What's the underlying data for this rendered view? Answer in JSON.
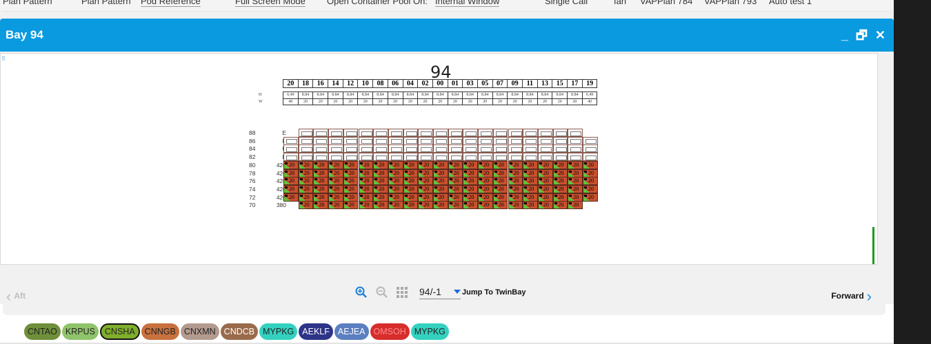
{
  "topbar": {
    "items": [
      "Plan Pattern",
      "Plan Pattern",
      "Pod Reference",
      "Full Screen Mode",
      "Open Container Pool On:",
      "Internal Window",
      "Single Call",
      "Ian",
      "VAPPlan 784",
      "VAPPlan 793",
      "Auto test 1"
    ]
  },
  "dialog": {
    "title": "Bay 94",
    "minimize_label": "_",
    "restore_label": "🗗",
    "close_label": "✕"
  },
  "bay": {
    "number": "94",
    "rows": [
      "20",
      "18",
      "16",
      "14",
      "12",
      "10",
      "08",
      "06",
      "04",
      "02",
      "00",
      "01",
      "03",
      "05",
      "07",
      "09",
      "11",
      "13",
      "15",
      "17",
      "19"
    ],
    "height_label": "H",
    "width_label": "W",
    "heights": [
      "6.49",
      "8.84",
      "8.84",
      "8.84",
      "8.84",
      "8.84",
      "8.84",
      "8.84",
      "8.84",
      "8.84",
      "8.84",
      "8.84",
      "8.84",
      "8.84",
      "8.84",
      "8.84",
      "8.84",
      "8.84",
      "8.84",
      "8.84",
      "6.49"
    ],
    "widths": [
      "40",
      "20",
      "20",
      "20",
      "20",
      "20",
      "20",
      "20",
      "20",
      "20",
      "20",
      "20",
      "20",
      "20",
      "20",
      "20",
      "20",
      "20",
      "20",
      "20",
      "40"
    ],
    "tiers": [
      {
        "tier": "88",
        "value": "E",
        "cols_from": 1,
        "cols_to": 19,
        "filled": false
      },
      {
        "tier": "86",
        "value": "E",
        "cols_from": 0,
        "cols_to": 20,
        "filled": false
      },
      {
        "tier": "84",
        "value": "E",
        "cols_from": 0,
        "cols_to": 20,
        "filled": false
      },
      {
        "tier": "82",
        "value": "E",
        "cols_from": 0,
        "cols_to": 20,
        "filled": false
      },
      {
        "tier": "80",
        "value": "420",
        "cols_from": 0,
        "cols_to": 20,
        "filled": true
      },
      {
        "tier": "78",
        "value": "420",
        "cols_from": 0,
        "cols_to": 20,
        "filled": true
      },
      {
        "tier": "76",
        "value": "420",
        "cols_from": 0,
        "cols_to": 20,
        "filled": true
      },
      {
        "tier": "74",
        "value": "420",
        "cols_from": 0,
        "cols_to": 20,
        "filled": true
      },
      {
        "tier": "72",
        "value": "420",
        "cols_from": 0,
        "cols_to": 20,
        "filled": true
      },
      {
        "tier": "70",
        "value": "380",
        "cols_from": 1,
        "cols_to": 19,
        "filled": true
      }
    ],
    "cell_weight": "20"
  },
  "navigation": {
    "aft_label": "Aft",
    "forward_label": "Forward",
    "bay_selector_value": "94/-1",
    "jump_label": "Jump To TwinBay"
  },
  "ports": [
    {
      "code": "CNTAO",
      "color": "#6f8f3a",
      "active": false
    },
    {
      "code": "KRPUS",
      "color": "#8fc46a",
      "active": false
    },
    {
      "code": "CNSHA",
      "color": "#7fae2c",
      "active": true
    },
    {
      "code": "CNNGB",
      "color": "#c8713f",
      "active": false
    },
    {
      "code": "CNXMN",
      "color": "#b39a8f",
      "active": false
    },
    {
      "code": "CNDCB",
      "color": "#9a6b4b",
      "active": false
    },
    {
      "code": "MYPKG",
      "color": "#34d1bf",
      "active": false
    },
    {
      "code": "AEKLF",
      "color": "#2d3487",
      "active": false
    },
    {
      "code": "AEJEA",
      "color": "#5b7fc0",
      "active": false
    },
    {
      "code": "OMSOH",
      "color": "#d72d2d",
      "active": false
    },
    {
      "code": "MYPKG",
      "color": "#34d1bf",
      "active": false
    }
  ]
}
